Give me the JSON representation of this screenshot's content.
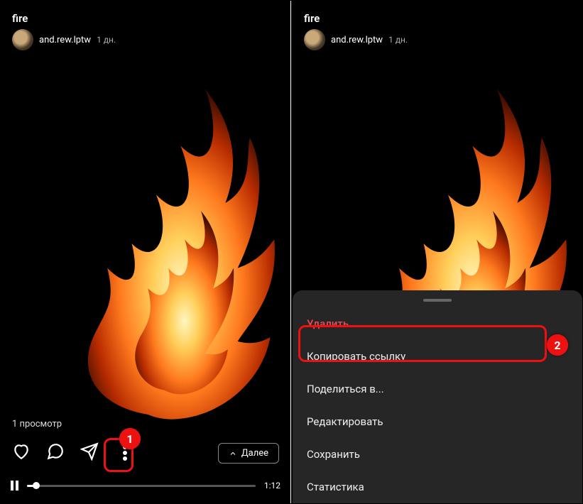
{
  "left": {
    "title": "fire",
    "username": "and.rew.lptw",
    "timestamp": "1 дн.",
    "views_label": "1 просмотр",
    "next_label": "Далее",
    "time_total": "1:12"
  },
  "right": {
    "title": "fire",
    "username": "and.rew.lptw",
    "timestamp": "1 дн.",
    "menu": {
      "delete": "Удалить",
      "copy_link": "Копировать ссылку",
      "share": "Поделиться в...",
      "edit": "Редактировать",
      "save": "Сохранить",
      "stats": "Статистика"
    }
  },
  "markers": {
    "one": "1",
    "two": "2"
  }
}
